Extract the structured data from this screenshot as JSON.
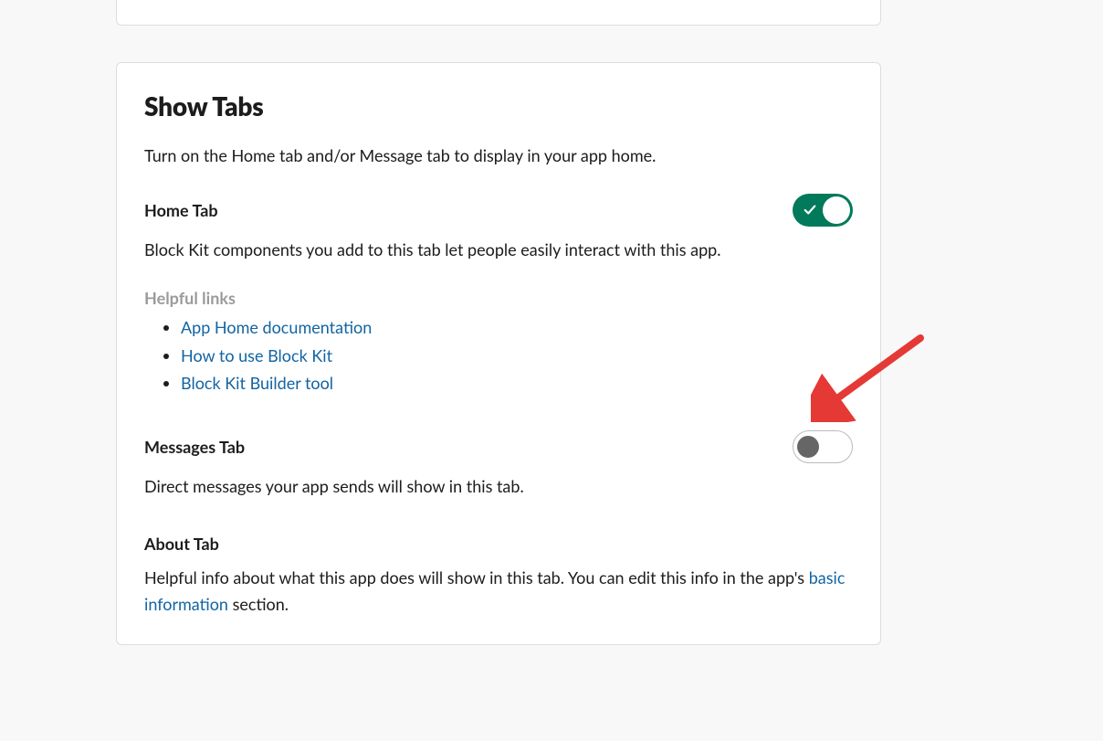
{
  "showTabs": {
    "title": "Show Tabs",
    "intro": "Turn on the Home tab and/or Message tab to display in your app home.",
    "homeTab": {
      "title": "Home Tab",
      "desc": "Block Kit components you add to this tab let people easily interact with this app.",
      "enabled": true
    },
    "helpful": {
      "heading": "Helpful links",
      "links": [
        {
          "label": "App Home documentation"
        },
        {
          "label": "How to use Block Kit"
        },
        {
          "label": "Block Kit Builder tool"
        }
      ]
    },
    "messagesTab": {
      "title": "Messages Tab",
      "desc": "Direct messages your app sends will show in this tab.",
      "enabled": false
    },
    "aboutTab": {
      "title": "About Tab",
      "desc_before": "Helpful info about what this app does will show in this tab. You can edit this info in the app's ",
      "link": "basic information",
      "desc_after": " section."
    }
  },
  "colors": {
    "toggleOn": "#007a5a",
    "link": "#1264a3",
    "arrow": "#e53935"
  }
}
